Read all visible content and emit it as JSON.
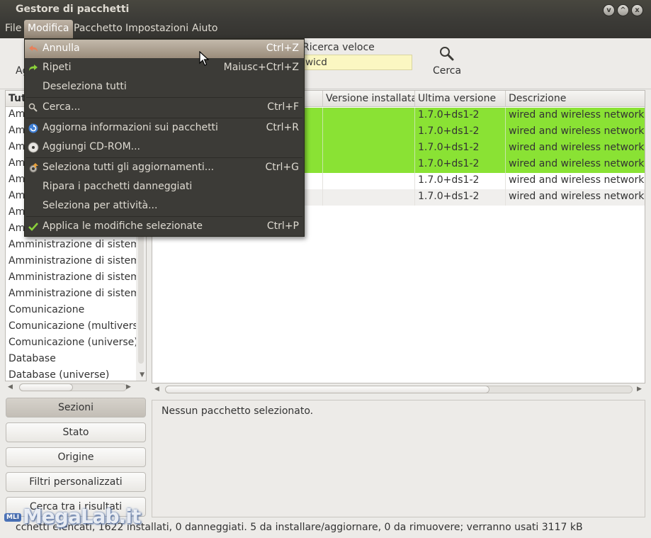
{
  "window": {
    "title": "Gestore di pacchetti",
    "controls": [
      "v",
      "^",
      "x"
    ]
  },
  "menubar": [
    "File",
    "Modifica",
    "Pacchetto",
    "Impostazioni",
    "Aiuto"
  ],
  "toolbar": {
    "cut_label": "Ag",
    "quick_search_label": "Ricerca veloce",
    "quick_search_value": "wicd",
    "search_button": "Cerca"
  },
  "edit_menu": [
    {
      "label": "Annulla",
      "accel": "Ctrl+Z",
      "icon": "undo-icon",
      "highlight": true
    },
    {
      "label": "Ripeti",
      "accel": "Maiusc+Ctrl+Z",
      "icon": "redo-icon"
    },
    {
      "label": "Deseleziona tutti",
      "accel": "",
      "icon": ""
    },
    {
      "label": "Cerca...",
      "accel": "Ctrl+F",
      "icon": "search-icon"
    },
    {
      "label": "Aggiorna informazioni sui pacchetti",
      "accel": "Ctrl+R",
      "icon": "refresh-icon"
    },
    {
      "label": "Aggiungi CD-ROM...",
      "accel": "",
      "icon": "cdrom-icon"
    },
    {
      "label": "Seleziona tutti gli aggiornamenti...",
      "accel": "Ctrl+G",
      "icon": "upgrade-icon"
    },
    {
      "label": "Ripara i pacchetti danneggiati",
      "accel": "",
      "icon": ""
    },
    {
      "label": "Seleziona per attività...",
      "accel": "",
      "icon": ""
    },
    {
      "label": "Applica le modifiche selezionate",
      "accel": "Ctrl+P",
      "icon": "check-icon"
    }
  ],
  "sections": {
    "header": "Tut",
    "items": [
      "Am",
      "Am",
      "Am",
      "Am",
      "Am",
      "Am",
      "Am",
      "Am",
      "Amministrazione di sistema",
      "Amministrazione di sistema",
      "Amministrazione di sistema",
      "Amministrazione di sistema",
      "Comunicazione",
      "Comunicazione (multiverse)",
      "Comunicazione (universe)",
      "Database",
      "Database (universe)"
    ]
  },
  "packages": {
    "columns": [
      "Versione installata",
      "Ultima versione",
      "Descrizione"
    ],
    "rows": [
      {
        "installed": "",
        "latest": "1.7.0+ds1-2",
        "description": "wired and wireless network m",
        "marked": true
      },
      {
        "installed": "",
        "latest": "1.7.0+ds1-2",
        "description": "wired and wireless network m",
        "marked": true
      },
      {
        "installed": "",
        "latest": "1.7.0+ds1-2",
        "description": "wired and wireless network m",
        "marked": true
      },
      {
        "installed": "",
        "latest": "1.7.0+ds1-2",
        "description": "wired and wireless network m",
        "marked": true
      },
      {
        "installed": "",
        "latest": "1.7.0+ds1-2",
        "description": "wired and wireless network m",
        "marked": false
      },
      {
        "installed": "",
        "latest": "1.7.0+ds1-2",
        "description": "wired and wireless network m",
        "marked": false
      }
    ]
  },
  "filter_buttons": [
    "Sezioni",
    "Stato",
    "Origine",
    "Filtri personalizzati",
    "Cerca tra i risultati"
  ],
  "details_message": "Nessun pacchetto selezionato.",
  "status": "cchetti elencati, 1622 installati, 0 danneggiati. 5 da installare/aggiornare, 0 da rimuovere; verranno usati 3117 kB",
  "watermark": {
    "badge": "MLI",
    "text": "MegaLab.it"
  },
  "colors": {
    "marked_row": "#8ae234",
    "menu_bg": "#3c3b37",
    "highlight": "#a89b8a"
  }
}
